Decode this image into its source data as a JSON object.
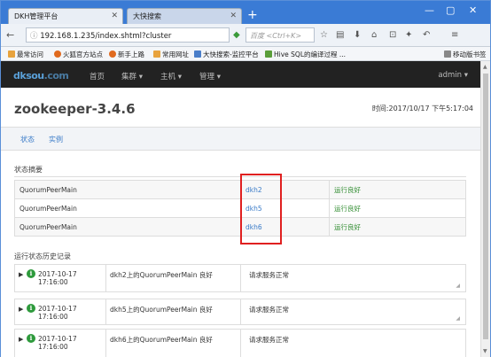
{
  "browser": {
    "tabs": [
      {
        "label": "DKH管理平台",
        "active": true
      },
      {
        "label": "大快搜索",
        "active": false
      }
    ],
    "new_tab": "+",
    "window_controls": [
      "—",
      "▢",
      "✕"
    ],
    "url": "192.168.1.235/index.shtml?cluster",
    "search_placeholder": "百度 <Ctrl+K>",
    "bookmarks": [
      {
        "label": "最常访问",
        "color": "#e8a33d"
      },
      {
        "label": "火狐官方站点",
        "color": "#e06a1e"
      },
      {
        "label": "新手上路",
        "color": "#e06a1e"
      },
      {
        "label": "常用网址",
        "color": "#e8a33d"
      },
      {
        "label": "大快搜索-监控平台",
        "color": "#4a7ec9"
      },
      {
        "label": "Hive SQL的编译过程 ...",
        "color": "#5a9e3a"
      }
    ],
    "mobile_bookmarks": "移动版书签"
  },
  "app": {
    "logo_main": "dk",
    "logo_sub": "sou",
    "logo_tail": ".com",
    "nav": [
      "首页",
      "集群 ▾",
      "主机 ▾",
      "管理 ▾"
    ],
    "user": "admin ▾"
  },
  "header": {
    "title": "zookeeper-3.4.6",
    "time": "时间:2017/10/17 下午5:17:04"
  },
  "subtabs": [
    "状态",
    "实例"
  ],
  "status_summary": {
    "title": "状态摘要",
    "rows": [
      {
        "role": "QuorumPeerMain",
        "host": "dkh2",
        "state": "运行良好"
      },
      {
        "role": "QuorumPeerMain",
        "host": "dkh5",
        "state": "运行良好"
      },
      {
        "role": "QuorumPeerMain",
        "host": "dkh6",
        "state": "运行良好"
      }
    ]
  },
  "history": {
    "title": "运行状态历史记录",
    "rows": [
      {
        "time": "2017-10-17 17:16:00",
        "desc": "dkh2上的QuorumPeerMain 良好",
        "msg": "请求服务正常"
      },
      {
        "time": "2017-10-17 17:16:00",
        "desc": "dkh5上的QuorumPeerMain 良好",
        "msg": "请求服务正常"
      },
      {
        "time": "2017-10-17 17:16:00",
        "desc": "dkh6上的QuorumPeerMain 良好",
        "msg": "请求服务正常"
      }
    ]
  }
}
